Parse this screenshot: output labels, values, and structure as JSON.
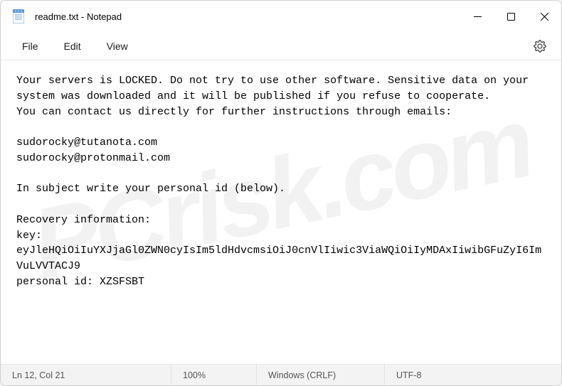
{
  "titlebar": {
    "title": "readme.txt - Notepad"
  },
  "menubar": {
    "file": "File",
    "edit": "Edit",
    "view": "View"
  },
  "body": "Your servers is LOCKED. Do not try to use other software. Sensitive data on your system was downloaded and it will be published if you refuse to cooperate.\nYou can contact us directly for further instructions through emails:\n\nsudorocky@tutanota.com\nsudorocky@protonmail.com\n\nIn subject write your personal id (below).\n\nRecovery information:\nkey:\neyJleHQiOiIuYXJjaGl0ZWN0cyIsIm5ldHdvcmsiOiJ0cnVlIiwic3ViaWQiOiIyMDAxIiwibGFuZyI6ImVuLVVTACJ9\npersonal id: XZSFSBT",
  "statusbar": {
    "position": "Ln 12, Col 21",
    "zoom": "100%",
    "eol": "Windows (CRLF)",
    "encoding": "UTF-8"
  },
  "watermark": "PCrisk.com"
}
